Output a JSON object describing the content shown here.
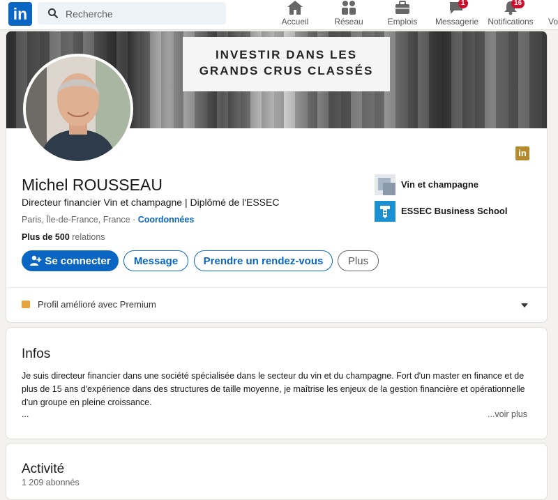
{
  "nav": {
    "search_placeholder": "Recherche",
    "items": [
      {
        "label": "Accueil",
        "icon": "home-icon"
      },
      {
        "label": "Réseau",
        "icon": "network-icon"
      },
      {
        "label": "Emplois",
        "icon": "briefcase-icon"
      },
      {
        "label": "Messagerie",
        "icon": "messaging-icon",
        "badge": "1"
      },
      {
        "label": "Notifications",
        "icon": "bell-icon",
        "badge": "16"
      },
      {
        "label": "Vo",
        "icon": "me-icon"
      }
    ]
  },
  "banner": {
    "text": "INVESTIR DANS LES\nGRANDS CRUS CLASSÉS"
  },
  "profile": {
    "name": "Michel ROUSSEAU",
    "headline": "Directeur financier Vin et champagne | Diplômé de l'ESSEC",
    "location": "Paris, Île-de-France, France · ",
    "contact_link": "Coordonnées",
    "relations_bold": "Plus de 500",
    "relations_rest": " relations",
    "orgs": [
      {
        "name": "Vin et champagne",
        "icon": "company-logo-icon"
      },
      {
        "name": "ESSEC Business School",
        "icon": "school-logo-icon"
      }
    ],
    "buttons": {
      "connect": "Se connecter",
      "message": "Message",
      "appointment": "Prendre un rendez-vous",
      "more": "Plus"
    },
    "premium": "Profil amélioré avec Premium"
  },
  "infos": {
    "title": "Infos",
    "text": "Je suis directeur financier dans une société spécialisée dans le secteur du vin et du champagne. Fort d'un master en finance et de plus de 15 ans d'expérience dans des structures de taille moyenne, je maîtrise les enjeux de la gestion financière et opérationnelle d'un groupe en pleine croissance.",
    "ellipsis": "...",
    "see_more": "...voir plus"
  },
  "activity": {
    "title": "Activité",
    "followers": "1 209 abonnés"
  },
  "colors": {
    "brand": "#0a66c2",
    "premium_gold": "#b58a2d",
    "notification_red": "#cb112d"
  }
}
